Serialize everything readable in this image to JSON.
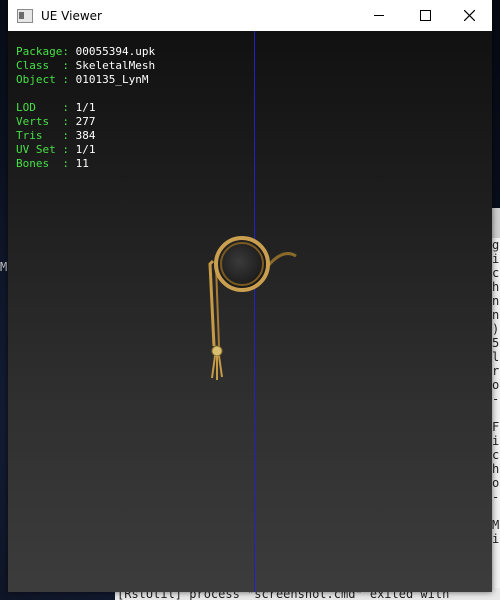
{
  "window": {
    "title": "UE Viewer"
  },
  "info": {
    "package": {
      "label": "Package: ",
      "value": "00055394.upk"
    },
    "class": {
      "label": "Class  : ",
      "value": "SkeletalMesh"
    },
    "object": {
      "label": "Object : ",
      "value": "010135_LynM"
    },
    "lod": {
      "label": "LOD    : ",
      "value": "1/1"
    },
    "verts": {
      "label": "Verts  : ",
      "value": "277"
    },
    "tris": {
      "label": "Tris   : ",
      "value": "384"
    },
    "uvset": {
      "label": "UV Set : ",
      "value": "1/1"
    },
    "bones": {
      "label": "Bones  : ",
      "value": "11"
    }
  },
  "background": {
    "desktop_letter": "M",
    "console_lines": [
      "g",
      "i",
      "c",
      "h",
      "n",
      "n",
      ")",
      "5",
      "l",
      "r",
      "o",
      "-",
      "",
      "F",
      "i",
      "c",
      "h",
      "o",
      "-",
      "",
      "M",
      "i"
    ],
    "console_bottom": "[RstUtil] process \"screenshot.cmd\" exited with"
  },
  "colors": {
    "label_green": "#46e046",
    "axis_blue": "#1c24c8"
  }
}
